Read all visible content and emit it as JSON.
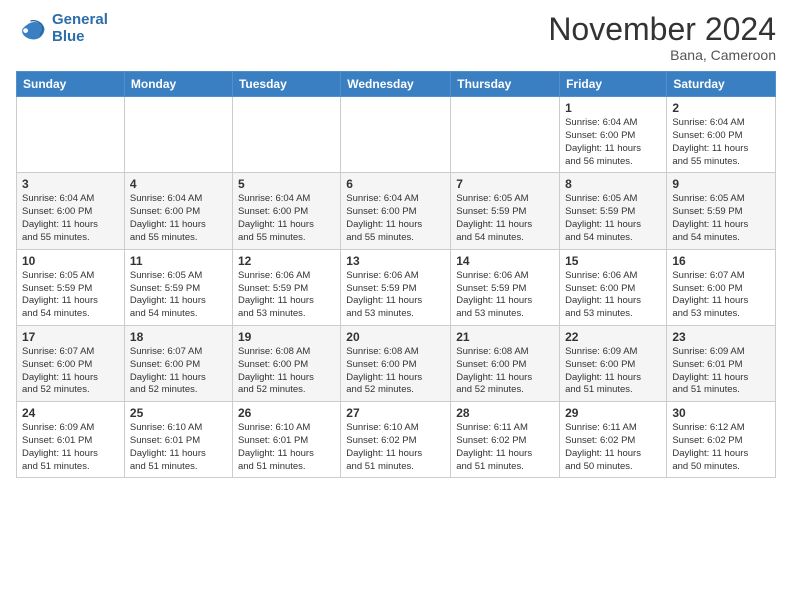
{
  "logo": {
    "line1": "General",
    "line2": "Blue"
  },
  "title": "November 2024",
  "location": "Bana, Cameroon",
  "days_header": [
    "Sunday",
    "Monday",
    "Tuesday",
    "Wednesday",
    "Thursday",
    "Friday",
    "Saturday"
  ],
  "weeks": [
    [
      {
        "day": "",
        "info": ""
      },
      {
        "day": "",
        "info": ""
      },
      {
        "day": "",
        "info": ""
      },
      {
        "day": "",
        "info": ""
      },
      {
        "day": "",
        "info": ""
      },
      {
        "day": "1",
        "info": "Sunrise: 6:04 AM\nSunset: 6:00 PM\nDaylight: 11 hours\nand 56 minutes."
      },
      {
        "day": "2",
        "info": "Sunrise: 6:04 AM\nSunset: 6:00 PM\nDaylight: 11 hours\nand 55 minutes."
      }
    ],
    [
      {
        "day": "3",
        "info": "Sunrise: 6:04 AM\nSunset: 6:00 PM\nDaylight: 11 hours\nand 55 minutes."
      },
      {
        "day": "4",
        "info": "Sunrise: 6:04 AM\nSunset: 6:00 PM\nDaylight: 11 hours\nand 55 minutes."
      },
      {
        "day": "5",
        "info": "Sunrise: 6:04 AM\nSunset: 6:00 PM\nDaylight: 11 hours\nand 55 minutes."
      },
      {
        "day": "6",
        "info": "Sunrise: 6:04 AM\nSunset: 6:00 PM\nDaylight: 11 hours\nand 55 minutes."
      },
      {
        "day": "7",
        "info": "Sunrise: 6:05 AM\nSunset: 5:59 PM\nDaylight: 11 hours\nand 54 minutes."
      },
      {
        "day": "8",
        "info": "Sunrise: 6:05 AM\nSunset: 5:59 PM\nDaylight: 11 hours\nand 54 minutes."
      },
      {
        "day": "9",
        "info": "Sunrise: 6:05 AM\nSunset: 5:59 PM\nDaylight: 11 hours\nand 54 minutes."
      }
    ],
    [
      {
        "day": "10",
        "info": "Sunrise: 6:05 AM\nSunset: 5:59 PM\nDaylight: 11 hours\nand 54 minutes."
      },
      {
        "day": "11",
        "info": "Sunrise: 6:05 AM\nSunset: 5:59 PM\nDaylight: 11 hours\nand 54 minutes."
      },
      {
        "day": "12",
        "info": "Sunrise: 6:06 AM\nSunset: 5:59 PM\nDaylight: 11 hours\nand 53 minutes."
      },
      {
        "day": "13",
        "info": "Sunrise: 6:06 AM\nSunset: 5:59 PM\nDaylight: 11 hours\nand 53 minutes."
      },
      {
        "day": "14",
        "info": "Sunrise: 6:06 AM\nSunset: 5:59 PM\nDaylight: 11 hours\nand 53 minutes."
      },
      {
        "day": "15",
        "info": "Sunrise: 6:06 AM\nSunset: 6:00 PM\nDaylight: 11 hours\nand 53 minutes."
      },
      {
        "day": "16",
        "info": "Sunrise: 6:07 AM\nSunset: 6:00 PM\nDaylight: 11 hours\nand 53 minutes."
      }
    ],
    [
      {
        "day": "17",
        "info": "Sunrise: 6:07 AM\nSunset: 6:00 PM\nDaylight: 11 hours\nand 52 minutes."
      },
      {
        "day": "18",
        "info": "Sunrise: 6:07 AM\nSunset: 6:00 PM\nDaylight: 11 hours\nand 52 minutes."
      },
      {
        "day": "19",
        "info": "Sunrise: 6:08 AM\nSunset: 6:00 PM\nDaylight: 11 hours\nand 52 minutes."
      },
      {
        "day": "20",
        "info": "Sunrise: 6:08 AM\nSunset: 6:00 PM\nDaylight: 11 hours\nand 52 minutes."
      },
      {
        "day": "21",
        "info": "Sunrise: 6:08 AM\nSunset: 6:00 PM\nDaylight: 11 hours\nand 52 minutes."
      },
      {
        "day": "22",
        "info": "Sunrise: 6:09 AM\nSunset: 6:00 PM\nDaylight: 11 hours\nand 51 minutes."
      },
      {
        "day": "23",
        "info": "Sunrise: 6:09 AM\nSunset: 6:01 PM\nDaylight: 11 hours\nand 51 minutes."
      }
    ],
    [
      {
        "day": "24",
        "info": "Sunrise: 6:09 AM\nSunset: 6:01 PM\nDaylight: 11 hours\nand 51 minutes."
      },
      {
        "day": "25",
        "info": "Sunrise: 6:10 AM\nSunset: 6:01 PM\nDaylight: 11 hours\nand 51 minutes."
      },
      {
        "day": "26",
        "info": "Sunrise: 6:10 AM\nSunset: 6:01 PM\nDaylight: 11 hours\nand 51 minutes."
      },
      {
        "day": "27",
        "info": "Sunrise: 6:10 AM\nSunset: 6:02 PM\nDaylight: 11 hours\nand 51 minutes."
      },
      {
        "day": "28",
        "info": "Sunrise: 6:11 AM\nSunset: 6:02 PM\nDaylight: 11 hours\nand 51 minutes."
      },
      {
        "day": "29",
        "info": "Sunrise: 6:11 AM\nSunset: 6:02 PM\nDaylight: 11 hours\nand 50 minutes."
      },
      {
        "day": "30",
        "info": "Sunrise: 6:12 AM\nSunset: 6:02 PM\nDaylight: 11 hours\nand 50 minutes."
      }
    ]
  ]
}
